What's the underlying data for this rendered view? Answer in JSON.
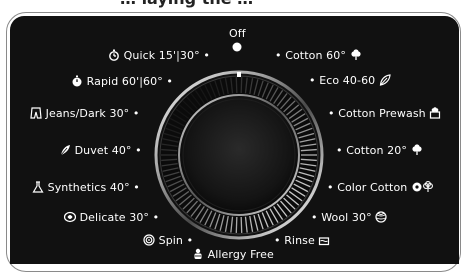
{
  "header": {
    "text": "… laying the …"
  },
  "dial": {
    "off_label": "Off",
    "programs_left": [
      {
        "label": "Quick 15'|30°",
        "icon": "stopwatch-icon"
      },
      {
        "label": "Rapid 60'|60°",
        "icon": "stopwatch-icon"
      },
      {
        "label": "Jeans/Dark 30°",
        "icon": "jeans-icon"
      },
      {
        "label": "Duvet 40°",
        "icon": "feather-icon"
      },
      {
        "label": "Synthetics 40°",
        "icon": "flask-icon"
      },
      {
        "label": "Delicate 30°",
        "icon": "delicate-icon"
      },
      {
        "label": "Spin",
        "icon": "spin-icon"
      }
    ],
    "programs_right": [
      {
        "label": "Cotton 60°",
        "icon": "cotton-icon"
      },
      {
        "label": "Eco 40-60",
        "icon": "leaf-icon"
      },
      {
        "label": "Cotton Prewash",
        "icon": "prewash-icon"
      },
      {
        "label": "Cotton 20°",
        "icon": "cotton-icon"
      },
      {
        "label": "Color Cotton",
        "icon": "color-cotton-icon"
      },
      {
        "label": "Wool 30°",
        "icon": "wool-icon"
      },
      {
        "label": "Rinse",
        "icon": "rinse-icon"
      }
    ],
    "bottom": {
      "label": "Allergy Free",
      "icon": "allergy-icon"
    }
  }
}
